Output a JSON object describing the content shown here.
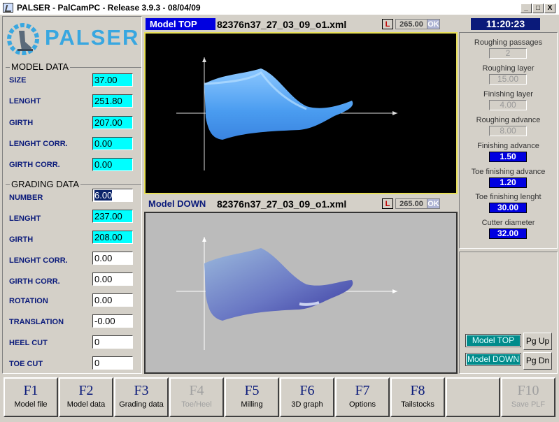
{
  "window": {
    "title": "PALSER - PalCamPC - Release 3.9.3 - 08/04/09",
    "controls": {
      "minimize": "_",
      "maximize": "□",
      "close": "X"
    }
  },
  "logo": {
    "text": "PALSER"
  },
  "model_data": {
    "title": "MODEL DATA",
    "fields": [
      {
        "label": "SIZE",
        "value": "37.00"
      },
      {
        "label": "LENGHT",
        "value": "251.80"
      },
      {
        "label": "GIRTH",
        "value": "207.00"
      },
      {
        "label": "LENGHT CORR.",
        "value": "0.00"
      },
      {
        "label": "GIRTH CORR.",
        "value": "0.00"
      }
    ]
  },
  "grading_data": {
    "title": "GRADING DATA",
    "fields": [
      {
        "label": "NUMBER",
        "value": "6.00"
      },
      {
        "label": "LENGHT",
        "value": "237.00"
      },
      {
        "label": "GIRTH",
        "value": "208.00"
      },
      {
        "label": "LENGHT CORR.",
        "value": "0.00"
      },
      {
        "label": "GIRTH CORR.",
        "value": "0.00"
      },
      {
        "label": "ROTATION",
        "value": "0.00"
      },
      {
        "label": "TRANSLATION",
        "value": "-0.00"
      },
      {
        "label": "HEEL CUT",
        "value": "0"
      },
      {
        "label": "TOE CUT",
        "value": "0"
      }
    ]
  },
  "view_top": {
    "title": "Model TOP",
    "filename": "82376n37_27_03_09_o1.xml",
    "l_label": "L",
    "number": "265.00",
    "ok": "OK"
  },
  "view_down": {
    "title": "Model DOWN",
    "filename": "82376n37_27_03_09_o1.xml",
    "l_label": "L",
    "number": "265.00",
    "ok": "OK"
  },
  "clock": "11:20:23",
  "params": [
    {
      "label": "Roughing passages",
      "value": "2"
    },
    {
      "label": "Roughing layer",
      "value": "15.00"
    },
    {
      "label": "Finishing layer",
      "value": "4.00"
    },
    {
      "label": "Roughing advance",
      "value": "8.00"
    },
    {
      "label": "Finishing advance",
      "value": "1.50"
    },
    {
      "label": "Toe finishing advance",
      "value": "1.20"
    },
    {
      "label": "Toe finishing lenght",
      "value": "30.00"
    },
    {
      "label": "Cutter diameter",
      "value": "32.00"
    }
  ],
  "view_buttons": {
    "model_top": "Model TOP",
    "model_down": "Model DOWN",
    "pg_up": "Pg Up",
    "pg_dn": "Pg Dn"
  },
  "fkeys": [
    {
      "key": "F1",
      "label": "Model file"
    },
    {
      "key": "F2",
      "label": "Model data"
    },
    {
      "key": "F3",
      "label": "Grading data"
    },
    {
      "key": "F4",
      "label": "Toe/Heel"
    },
    {
      "key": "F5",
      "label": "Milling"
    },
    {
      "key": "F6",
      "label": "3D graph"
    },
    {
      "key": "F7",
      "label": "Options"
    },
    {
      "key": "F8",
      "label": "Tailstocks"
    },
    {
      "key": "",
      "label": ""
    },
    {
      "key": "F10",
      "label": "Save PLF"
    }
  ]
}
